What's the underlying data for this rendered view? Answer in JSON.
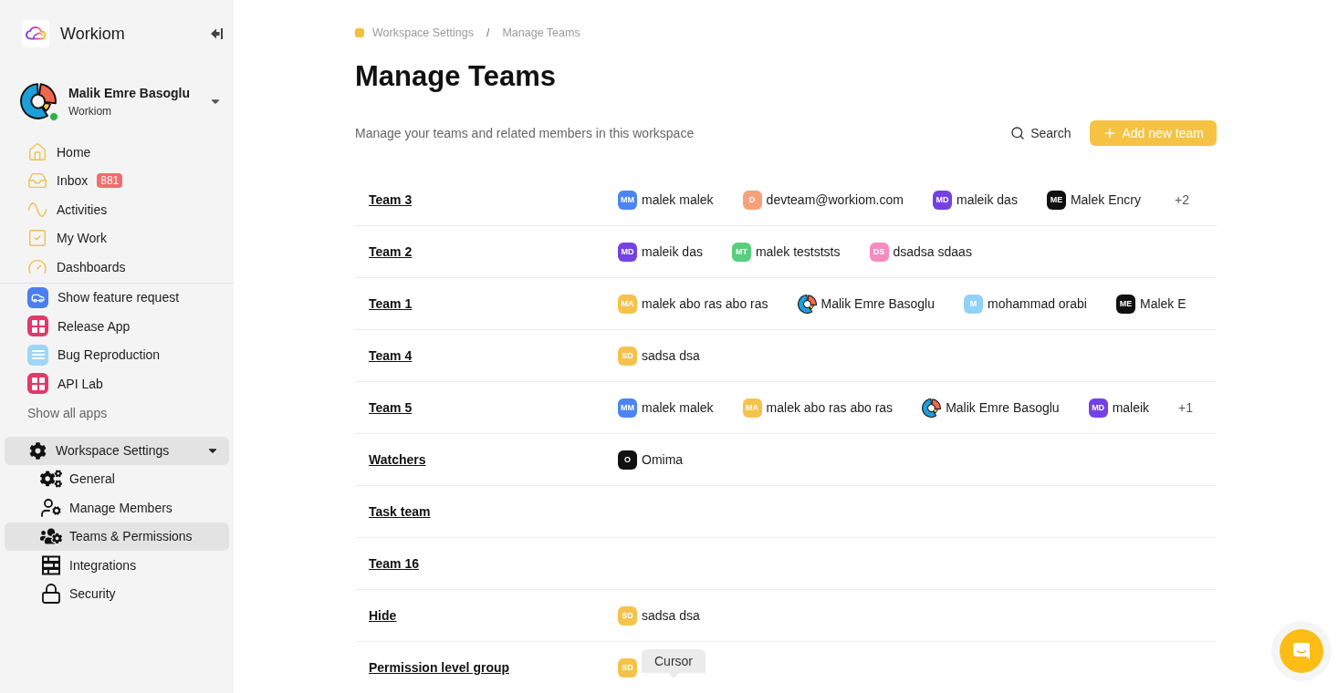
{
  "sidebar": {
    "brand": "Workiom",
    "user": {
      "name": "Malik Emre Basoglu",
      "workspace": "Workiom",
      "online": true
    },
    "nav": [
      {
        "label": "Home"
      },
      {
        "label": "Inbox",
        "badge": "881"
      },
      {
        "label": "Activities"
      },
      {
        "label": "My Work"
      },
      {
        "label": "Dashboards"
      }
    ],
    "apps": [
      {
        "label": "Show feature request",
        "color": "#4b7ff0"
      },
      {
        "label": "Release App",
        "color": "#e2386a"
      },
      {
        "label": "Bug Reproduction",
        "color": "#9dd6f6"
      },
      {
        "label": "API Lab",
        "color": "#e2386a"
      }
    ],
    "show_all_apps": "Show all apps",
    "settings": {
      "label": "Workspace Settings",
      "selected": true,
      "expanded": true,
      "items": [
        {
          "label": "General",
          "selected": false
        },
        {
          "label": "Manage Members",
          "selected": false
        },
        {
          "label": "Teams & Permissions",
          "selected": true
        },
        {
          "label": "Integrations",
          "selected": false
        },
        {
          "label": "Security",
          "selected": false
        }
      ]
    }
  },
  "breadcrumb": {
    "items": [
      "Workspace Settings",
      "Manage Teams"
    ],
    "separator": "/"
  },
  "title": "Manage Teams",
  "description": "Manage your teams and related members in this workspace",
  "search": {
    "label": "Search"
  },
  "add_button": {
    "label": "Add new team"
  },
  "teams": [
    {
      "name": "Team 3",
      "more": "+2",
      "members": [
        {
          "kind": "initials",
          "initials": "MM",
          "name": "malek malek",
          "color": "#4c84f2"
        },
        {
          "kind": "initials",
          "initials": "D",
          "name": "devteam@workiom.com",
          "color": "#f5a27b"
        },
        {
          "kind": "initials",
          "initials": "MD",
          "name": "maleik das",
          "color": "#7442e3"
        },
        {
          "kind": "initials",
          "initials": "ME",
          "name": "Malek Encry",
          "color": "#111111"
        }
      ]
    },
    {
      "name": "Team 2",
      "members": [
        {
          "kind": "initials",
          "initials": "MD",
          "name": "maleik das",
          "color": "#7442e3"
        },
        {
          "kind": "initials",
          "initials": "MT",
          "name": "malek testststs",
          "color": "#56cf7e"
        },
        {
          "kind": "initials",
          "initials": "DS",
          "name": "dsadsa sdaas",
          "color": "#f48cbf"
        }
      ]
    },
    {
      "name": "Team 1",
      "members": [
        {
          "kind": "initials",
          "initials": "MA",
          "name": "malek abo ras abo ras",
          "color": "#f5c34b"
        },
        {
          "kind": "picture",
          "name": "Malik Emre Basoglu"
        },
        {
          "kind": "initials",
          "initials": "M",
          "name": "mohammad orabi",
          "color": "#90d3f7"
        },
        {
          "kind": "initials",
          "initials": "ME",
          "name": "Malek E",
          "color": "#111111"
        }
      ]
    },
    {
      "name": "Team 4",
      "members": [
        {
          "kind": "initials",
          "initials": "SD",
          "name": "sadsa dsa",
          "color": "#f5c34b"
        }
      ]
    },
    {
      "name": "Team 5",
      "more": "+1",
      "members": [
        {
          "kind": "initials",
          "initials": "MM",
          "name": "malek malek",
          "color": "#4c84f2"
        },
        {
          "kind": "initials",
          "initials": "MA",
          "name": "malek abo ras abo ras",
          "color": "#f5c34b"
        },
        {
          "kind": "picture",
          "name": "Malik Emre Basoglu"
        },
        {
          "kind": "initials",
          "initials": "MD",
          "name": "maleik",
          "color": "#7442e3"
        }
      ]
    },
    {
      "name": "Watchers",
      "members": [
        {
          "kind": "initials",
          "initials": "O",
          "name": "Omima",
          "color": "#111111"
        }
      ]
    },
    {
      "name": "Task team"
    },
    {
      "name": "Team 16"
    },
    {
      "name": "Hide",
      "members": [
        {
          "kind": "initials",
          "initials": "SD",
          "name": "sadsa dsa",
          "color": "#f5c34b"
        }
      ]
    },
    {
      "name": "Permission level group",
      "members": [
        {
          "kind": "initials",
          "initials": "SD",
          "color": "#f5c34b",
          "tooltip": "Cursor"
        }
      ]
    }
  ]
}
